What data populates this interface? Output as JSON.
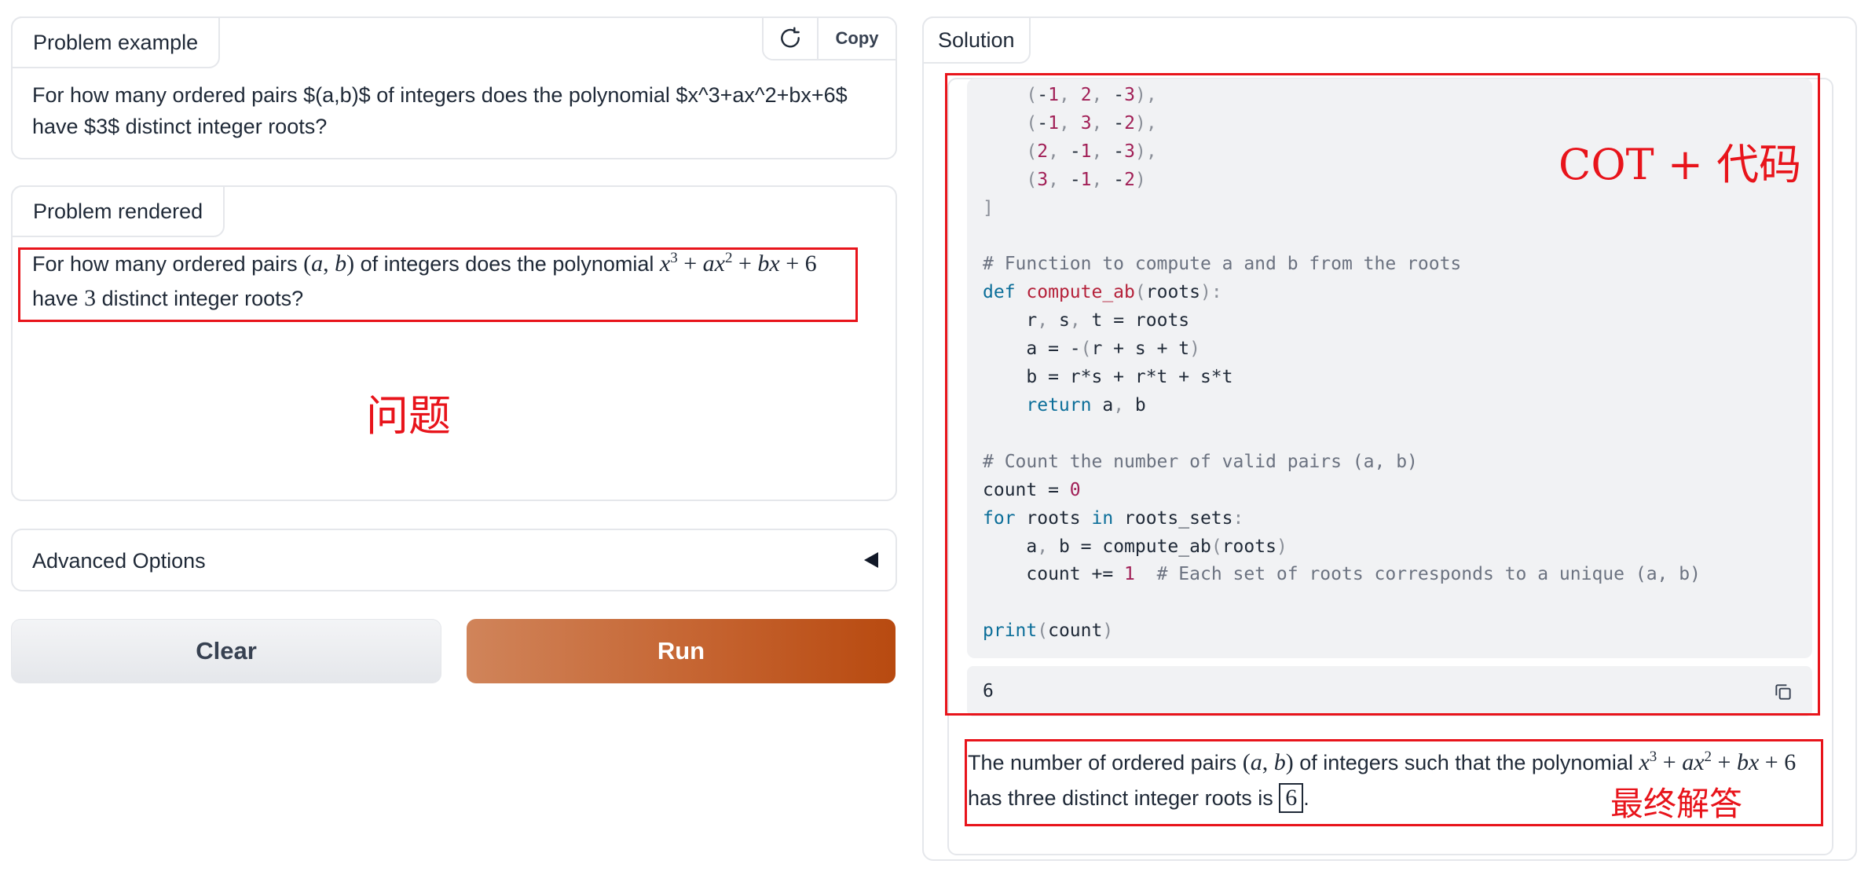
{
  "problem_example": {
    "label": "Problem example",
    "text": "For how many ordered pairs $(a,b)$ of integers does the polynomial $x^3+ax^2+bx+6$ have $3$ distinct integer roots?",
    "copy_label": "Copy",
    "refresh_icon": "refresh-icon"
  },
  "problem_rendered": {
    "label": "Problem rendered",
    "t1": "For how many ordered pairs ",
    "t2": " of integers does the polynomial ",
    "t3": "have ",
    "t4": " distinct integer roots?",
    "num_roots": "3"
  },
  "advanced_options": {
    "label": "Advanced Options",
    "caret_icon": "caret-left-icon"
  },
  "buttons": {
    "clear": "Clear",
    "run": "Run"
  },
  "solution": {
    "label": "Solution",
    "code_lines": [
      "    (-1, 2, -3),",
      "    (-1, 3, -2),",
      "    (2, -1, -3),",
      "    (3, -1, -2)",
      "]",
      "",
      "# Function to compute a and b from the roots",
      "def compute_ab(roots):",
      "    r, s, t = roots",
      "    a = -(r + s + t)",
      "    b = r*s + r*t + s*t",
      "    return a, b",
      "",
      "# Count the number of valid pairs (a, b)",
      "count = 0",
      "for roots in roots_sets:",
      "    a, b = compute_ab(roots)",
      "    count += 1  # Each set of roots corresponds to a unique (a, b)",
      "",
      "print(count)"
    ],
    "output": "6",
    "answer": {
      "t1": "The number of ordered pairs ",
      "t2": " of integers such that the polynomial ",
      "t3": " has three distinct integer roots is ",
      "t4": ".",
      "boxed": "6"
    }
  },
  "annotations": {
    "question": "问题",
    "cot_code": "COT + 代码",
    "final_answer": "最终解答",
    "color": "#e8141b"
  }
}
